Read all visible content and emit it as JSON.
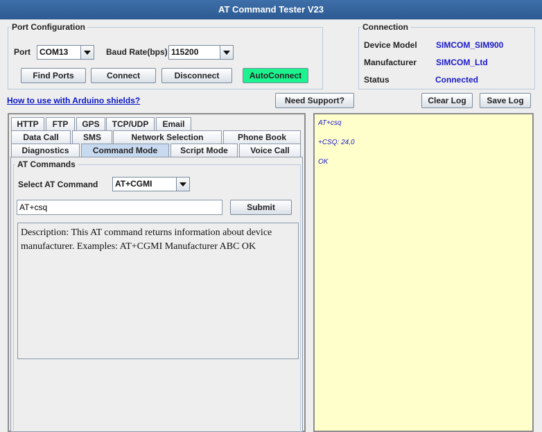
{
  "app": {
    "title": "AT Command Tester V23"
  },
  "port_config": {
    "legend": "Port Configuration",
    "port_label": "Port",
    "port_value": "COM13",
    "baud_label": "Baud Rate(bps)",
    "baud_value": "115200",
    "find_ports": "Find Ports",
    "connect": "Connect",
    "disconnect": "Disconnect",
    "autoconnect": "AutoConnect"
  },
  "connection": {
    "legend": "Connection",
    "device_model_label": "Device Model",
    "device_model_value": "SIMCOM_SIM900",
    "manufacturer_label": "Manufacturer",
    "manufacturer_value": "SIMCOM_Ltd",
    "status_label": "Status",
    "status_value": "Connected"
  },
  "links": {
    "arduino": "How to use with Arduino shields?"
  },
  "toolbar": {
    "need_support": "Need Support?",
    "clear_log": "Clear Log",
    "save_log": "Save Log"
  },
  "tabs": {
    "row1": [
      "HTTP",
      "FTP",
      "GPS",
      "TCP/UDP",
      "Email"
    ],
    "row2": [
      "Data Call",
      "SMS",
      "Network Selection",
      "Phone Book"
    ],
    "row3": [
      "Diagnostics",
      "Command Mode",
      "Script Mode",
      "Voice Call"
    ],
    "selected": "Command Mode"
  },
  "at_commands": {
    "legend": "AT Commands",
    "select_label": "Select AT Command",
    "select_value": "AT+CGMI",
    "input_value": "AT+csq",
    "submit": "Submit",
    "description": "Description: This AT command returns information about device manufacturer. Examples: AT+CGMI Manufacturer ABC OK"
  },
  "log": {
    "lines": [
      "AT+csq",
      "+CSQ: 24,0",
      "OK"
    ]
  },
  "colors": {
    "title_bar": "#2c5a92",
    "accent_value": "#1a1acc",
    "autoconnect_bg": "#1cf28e",
    "log_bg": "#ffffcc"
  }
}
